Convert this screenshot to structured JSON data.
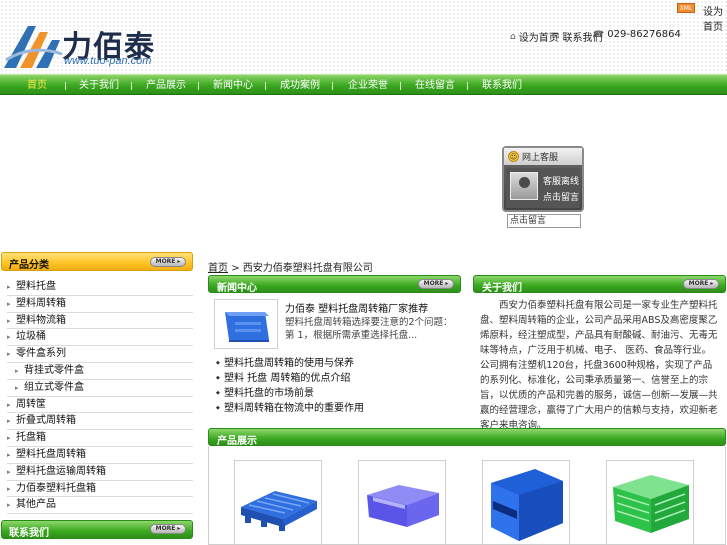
{
  "top_bar": {
    "xml_badge": "XML",
    "link_label": "设为首页"
  },
  "brand": {
    "name": "力佰泰",
    "url_text": "www.tuo-pan.com"
  },
  "header_links": {
    "home_label": "设为首页",
    "contact_label": "联系我们",
    "phone": "029-86276864"
  },
  "nav": {
    "items": [
      "首页",
      "关于我们",
      "产品展示",
      "新闻中心",
      "成功案例",
      "企业荣誉",
      "在线留言",
      "联系我们"
    ],
    "active_index": 0
  },
  "service_widget": {
    "title": "网上客服",
    "status": "客服离线",
    "action": "点击留言",
    "input_value": "点击留言"
  },
  "sidebar": {
    "category_title": "产品分类",
    "more_label": "MORE",
    "categories": [
      {
        "label": "塑料托盘",
        "sub": false
      },
      {
        "label": "塑料周转箱",
        "sub": false
      },
      {
        "label": "塑料物流箱",
        "sub": false
      },
      {
        "label": "垃圾桶",
        "sub": false
      },
      {
        "label": "零件盒系列",
        "sub": false
      },
      {
        "label": "背挂式零件盒",
        "sub": true
      },
      {
        "label": "组立式零件盒",
        "sub": true
      },
      {
        "label": "周转筐",
        "sub": false
      },
      {
        "label": "折叠式周转箱",
        "sub": false
      },
      {
        "label": "托盘箱",
        "sub": false
      },
      {
        "label": "塑料托盘周转箱",
        "sub": false
      },
      {
        "label": "塑料托盘运输周转箱",
        "sub": false
      },
      {
        "label": "力佰泰塑料托盘箱",
        "sub": false
      },
      {
        "label": "其他产品",
        "sub": false
      }
    ],
    "contact_title": "联系我们"
  },
  "breadcrumb": {
    "home": "首页",
    "separator": ">",
    "current": "西安力佰泰塑料托盘有限公司"
  },
  "news": {
    "title": "新闻中心",
    "more_label": "MORE",
    "headline": "力佰泰 塑料托盘周转箱厂家推荐",
    "summary": "塑料托盘周转箱选择要注意的2个问题：第 1，根据所需承重选择托盘...",
    "items": [
      "塑料托盘周转箱的使用与保养",
      "塑料 托盘 周转箱的优点介绍",
      "塑料托盘的市场前景",
      "塑料周转箱在物流中的重要作用"
    ]
  },
  "about": {
    "title": "关于我们",
    "more_label": "MORE",
    "text": "西安力佰泰塑料托盘有限公司是一家专业生产塑料托盘、塑料周转箱的企业，公司产品采用ABS及高密度聚乙烯原料，经注塑成型，产品具有耐酸碱、耐油污、无毒无味等特点，广泛用于机械、电子、 医药、食品等行业。公司拥有注塑机120台，托盘3600种规格，实现了产品的系列化、标准化，公司秉承质量第一、信誉至上的宗旨，以优质的产品和完善的服务，诚信—创新—发展—共赢的经营理念，赢得了广大用户的信赖与支持，欢迎新老客户来电咨询。"
  },
  "products": {
    "title": "产品展示"
  },
  "colors": {
    "nav_green": "#3aa820",
    "nav_active": "#ffe94a",
    "sidebar_orange": "#ffc324",
    "product_blue": "#2f6fe0",
    "product_green": "#2ec24a"
  }
}
